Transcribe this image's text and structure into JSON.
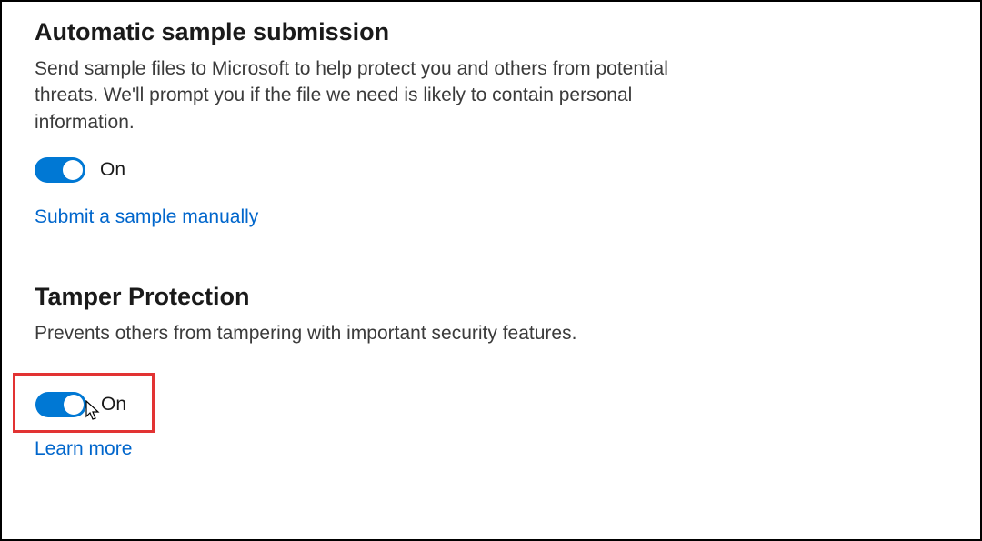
{
  "sections": {
    "auto_sample": {
      "title": "Automatic sample submission",
      "desc": "Send sample files to Microsoft to help protect you and others from potential threats. We'll prompt you if the file we need is likely to contain personal information.",
      "toggle_state": "On",
      "link": "Submit a sample manually"
    },
    "tamper": {
      "title": "Tamper Protection",
      "desc": "Prevents others from tampering with important security features.",
      "toggle_state": "On",
      "link": "Learn more"
    }
  },
  "colors": {
    "accent": "#0078d4",
    "link": "#0066cc",
    "highlight": "#e23333"
  }
}
